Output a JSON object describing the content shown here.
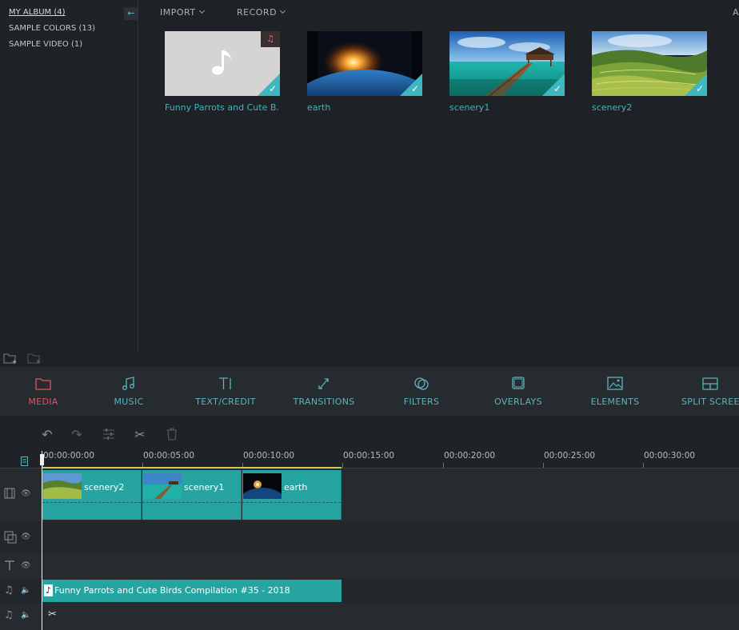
{
  "sidebar": {
    "items": [
      {
        "label": "MY ALBUM (4)",
        "active": true
      },
      {
        "label": "SAMPLE COLORS (13)",
        "active": false
      },
      {
        "label": "SAMPLE VIDEO (1)",
        "active": false
      }
    ],
    "collapse_icon": "arrow-left-icon"
  },
  "library": {
    "menus": [
      {
        "label": "IMPORT"
      },
      {
        "label": "RECORD"
      }
    ],
    "right_cut_text": "A",
    "media": [
      {
        "caption": "Funny Parrots and Cute B...",
        "kind": "audio",
        "selected": true
      },
      {
        "caption": "earth",
        "kind": "image",
        "selected": true
      },
      {
        "caption": "scenery1",
        "kind": "image",
        "selected": true
      },
      {
        "caption": "scenery2",
        "kind": "image",
        "selected": true
      }
    ],
    "bottom_icons": [
      "new-folder-icon",
      "delete-folder-icon"
    ]
  },
  "tabs": [
    {
      "label": "MEDIA",
      "icon": "folder-icon",
      "active": true
    },
    {
      "label": "MUSIC",
      "icon": "music-note-icon",
      "active": false
    },
    {
      "label": "TEXT/CREDIT",
      "icon": "text-icon",
      "active": false
    },
    {
      "label": "TRANSITIONS",
      "icon": "transitions-icon",
      "active": false
    },
    {
      "label": "FILTERS",
      "icon": "filters-icon",
      "active": false
    },
    {
      "label": "OVERLAYS",
      "icon": "overlays-icon",
      "active": false
    },
    {
      "label": "ELEMENTS",
      "icon": "elements-icon",
      "active": false
    },
    {
      "label": "SPLIT SCREEN",
      "icon": "split-screen-icon",
      "active": false
    }
  ],
  "tools": [
    "undo-icon",
    "redo-icon",
    "adjust-icon",
    "cut-icon",
    "delete-icon"
  ],
  "timeline": {
    "ticks": [
      "00:00:00:00",
      "00:00:05:00",
      "00:00:10:00",
      "00:00:15:00",
      "00:00:20:00",
      "00:00:25:00",
      "00:00:30:00"
    ],
    "video_clips": [
      {
        "name": "scenery2"
      },
      {
        "name": "scenery1"
      },
      {
        "name": "earth"
      }
    ],
    "audio_clip": {
      "name": "Funny Parrots and Cute Birds Compilation #35 - 2018"
    },
    "track_icons": [
      "film-icon",
      "pip-icon",
      "text-track-icon",
      "music-track-icon",
      "music-track-icon"
    ]
  },
  "colors": {
    "accent": "#3fb7c0",
    "active_tab": "#e0545e",
    "clip": "#25a4a1"
  }
}
